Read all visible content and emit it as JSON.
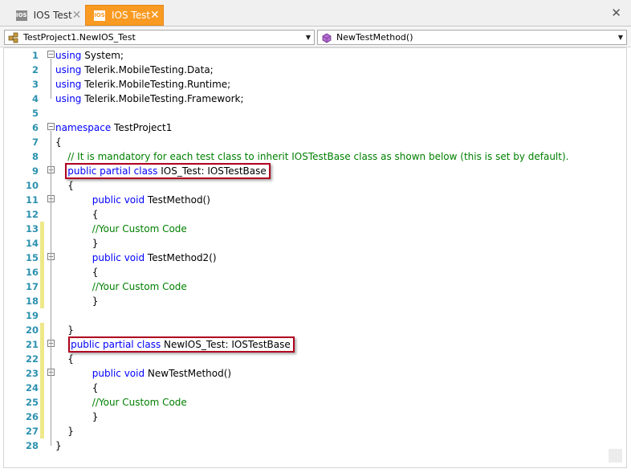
{
  "tabs": [
    {
      "label": "IOS Test",
      "icon": "ios-file-icon",
      "icon_text": "IOS",
      "active": false
    },
    {
      "label": "IOS Test",
      "icon": "ios-file-icon",
      "icon_text": "IOS",
      "active": true
    }
  ],
  "tab_close_glyph": "✕",
  "window_close_glyph": "✕",
  "navbar": {
    "class_combo": {
      "value": "TestProject1.NewIOS_Test",
      "icon": "class-icon"
    },
    "member_combo": {
      "value": "NewTestMethod()",
      "icon": "method-icon"
    }
  },
  "colors": {
    "active_tab": "#f99a22",
    "keyword": "#0000ff",
    "comment": "#008000",
    "line_number": "#2b91af",
    "change_bar": "#eee88a",
    "highlight_box": "#b00020"
  },
  "editor": {
    "lines": [
      {
        "n": "1",
        "fold": "minus",
        "changed": false,
        "tokens": [
          {
            "t": "kw",
            "v": "using"
          },
          {
            "t": "tx",
            "v": " System;"
          }
        ]
      },
      {
        "n": "2",
        "fold": "",
        "changed": false,
        "tokens": [
          {
            "t": "kw",
            "v": "using"
          },
          {
            "t": "tx",
            "v": " Telerik.MobileTesting.Data;"
          }
        ]
      },
      {
        "n": "3",
        "fold": "",
        "changed": false,
        "tokens": [
          {
            "t": "kw",
            "v": "using"
          },
          {
            "t": "tx",
            "v": " Telerik.MobileTesting.Runtime;"
          }
        ]
      },
      {
        "n": "4",
        "fold": "end",
        "changed": false,
        "tokens": [
          {
            "t": "kw",
            "v": "using"
          },
          {
            "t": "tx",
            "v": " Telerik.MobileTesting.Framework;"
          }
        ]
      },
      {
        "n": "5",
        "fold": "",
        "changed": false,
        "tokens": []
      },
      {
        "n": "6",
        "fold": "minus",
        "changed": false,
        "tokens": [
          {
            "t": "kw",
            "v": "namespace"
          },
          {
            "t": "tx",
            "v": " TestProject1"
          }
        ]
      },
      {
        "n": "7",
        "fold": "",
        "changed": false,
        "tokens": [
          {
            "t": "tx",
            "v": "{"
          }
        ]
      },
      {
        "n": "8",
        "fold": "",
        "changed": false,
        "tokens": [
          {
            "t": "cm",
            "v": "    // It is mandatory for each test class to inherit IOSTestBase class as shown below (this is set by default)."
          }
        ]
      },
      {
        "n": "9",
        "fold": "minus",
        "changed": false,
        "tokens": [
          {
            "t": "tx",
            "v": "    "
          },
          {
            "t": "kw",
            "v": "public partial class"
          },
          {
            "t": "tx",
            "v": " IOS_Test: IOSTestBase"
          }
        ]
      },
      {
        "n": "10",
        "fold": "",
        "changed": false,
        "tokens": [
          {
            "t": "tx",
            "v": "    {"
          }
        ]
      },
      {
        "n": "11",
        "fold": "minus",
        "changed": false,
        "tokens": [
          {
            "t": "tx",
            "v": "            "
          },
          {
            "t": "kw",
            "v": "public void"
          },
          {
            "t": "tx",
            "v": " TestMethod()"
          }
        ]
      },
      {
        "n": "12",
        "fold": "",
        "changed": false,
        "tokens": [
          {
            "t": "tx",
            "v": "            {"
          }
        ]
      },
      {
        "n": "13",
        "fold": "",
        "changed": true,
        "tokens": [
          {
            "t": "cm",
            "v": "            //Your Custom Code"
          }
        ]
      },
      {
        "n": "14",
        "fold": "end",
        "changed": true,
        "tokens": [
          {
            "t": "tx",
            "v": "            }"
          }
        ]
      },
      {
        "n": "15",
        "fold": "minus",
        "changed": true,
        "tokens": [
          {
            "t": "tx",
            "v": "            "
          },
          {
            "t": "kw",
            "v": "public void"
          },
          {
            "t": "tx",
            "v": " TestMethod2()"
          }
        ]
      },
      {
        "n": "16",
        "fold": "",
        "changed": true,
        "tokens": [
          {
            "t": "tx",
            "v": "            {"
          }
        ]
      },
      {
        "n": "17",
        "fold": "",
        "changed": true,
        "tokens": [
          {
            "t": "cm",
            "v": "            //Your Custom Code"
          }
        ]
      },
      {
        "n": "18",
        "fold": "end",
        "changed": true,
        "tokens": [
          {
            "t": "tx",
            "v": "            }"
          }
        ]
      },
      {
        "n": "19",
        "fold": "",
        "changed": false,
        "tokens": []
      },
      {
        "n": "20",
        "fold": "end",
        "changed": true,
        "tokens": [
          {
            "t": "tx",
            "v": "    }"
          }
        ]
      },
      {
        "n": "21",
        "fold": "minus",
        "changed": true,
        "tokens": [
          {
            "t": "tx",
            "v": "     "
          },
          {
            "t": "kw",
            "v": "public partial class"
          },
          {
            "t": "tx",
            "v": " NewIOS_Test: IOSTestBase"
          }
        ]
      },
      {
        "n": "22",
        "fold": "",
        "changed": true,
        "tokens": [
          {
            "t": "tx",
            "v": "    {"
          }
        ]
      },
      {
        "n": "23",
        "fold": "minus",
        "changed": true,
        "tokens": [
          {
            "t": "tx",
            "v": "            "
          },
          {
            "t": "kw",
            "v": "public void"
          },
          {
            "t": "tx",
            "v": " NewTestMethod()"
          }
        ]
      },
      {
        "n": "24",
        "fold": "",
        "changed": true,
        "tokens": [
          {
            "t": "tx",
            "v": "            {"
          }
        ]
      },
      {
        "n": "25",
        "fold": "",
        "changed": true,
        "tokens": [
          {
            "t": "cm",
            "v": "            //Your Custom Code"
          }
        ]
      },
      {
        "n": "26",
        "fold": "end",
        "changed": true,
        "tokens": [
          {
            "t": "tx",
            "v": "            }"
          }
        ]
      },
      {
        "n": "27",
        "fold": "end",
        "changed": true,
        "tokens": [
          {
            "t": "tx",
            "v": "    }"
          }
        ]
      },
      {
        "n": "28",
        "fold": "end",
        "changed": false,
        "tokens": [
          {
            "t": "tx",
            "v": "}"
          }
        ]
      }
    ],
    "highlighted_lines": [
      "9",
      "21"
    ]
  }
}
